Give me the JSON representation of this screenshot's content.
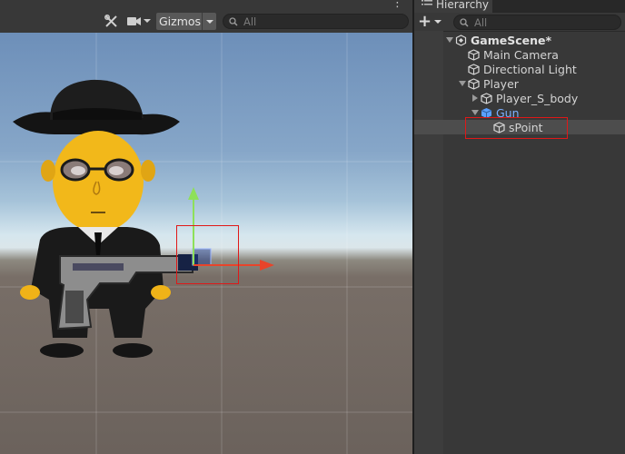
{
  "scene_toolbar": {
    "gizmos_label": "Gizmos",
    "search_placeholder": "All",
    "more_icon": "ellipsis-vertical-icon",
    "tools_icon": "tools-crossed-icon",
    "camera_icon": "video-camera-icon"
  },
  "hierarchy": {
    "tab_label": "Hierarchy",
    "add_label": "+",
    "search_placeholder": "All",
    "items": [
      {
        "label": "GameScene*",
        "depth": 0,
        "expanded": true,
        "kind": "scene"
      },
      {
        "label": "Main Camera",
        "depth": 1,
        "expanded": null,
        "kind": "gameobject"
      },
      {
        "label": "Directional Light",
        "depth": 1,
        "expanded": null,
        "kind": "gameobject"
      },
      {
        "label": "Player",
        "depth": 1,
        "expanded": true,
        "kind": "gameobject"
      },
      {
        "label": "Player_S_body",
        "depth": 2,
        "expanded": false,
        "kind": "gameobject"
      },
      {
        "label": "Gun",
        "depth": 2,
        "expanded": true,
        "kind": "prefab"
      },
      {
        "label": "sPoint",
        "depth": 3,
        "expanded": null,
        "kind": "gameobject",
        "selected": true
      }
    ]
  },
  "colors": {
    "highlight_box": "#e01818",
    "prefab_text": "#7cb0ff",
    "gizmo_y": "#8ee05a",
    "gizmo_x": "#e8442a"
  }
}
